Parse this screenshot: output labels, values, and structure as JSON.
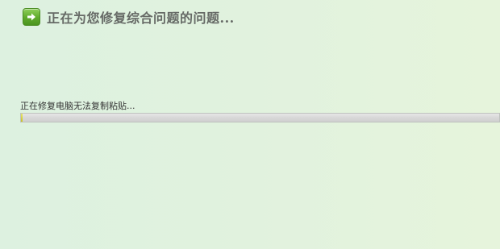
{
  "header": {
    "icon": "arrow-right-icon",
    "title": "正在为您修复综合问题的问题..."
  },
  "status": {
    "text": "正在修复电脑无法复制粘贴..."
  },
  "progress": {
    "fraction": 0.004
  },
  "colors": {
    "icon_green": "#5faa2c",
    "title_gray": "#666a66",
    "progress_fill": "#c7c227"
  }
}
